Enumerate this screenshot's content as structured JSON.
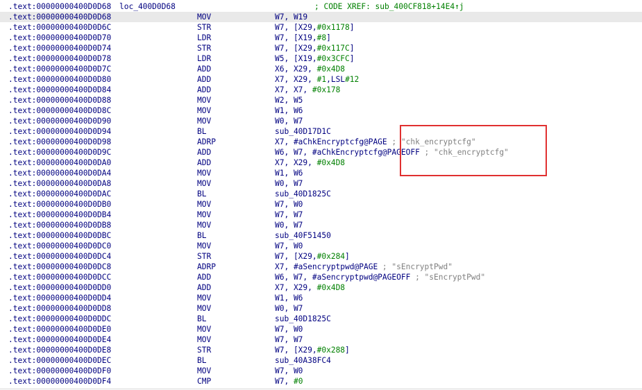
{
  "header": {
    "address": ".text:00000000400D0D68",
    "label": "loc_400D0D68",
    "xref": "; CODE XREF: sub_400CF818+14E4↑j"
  },
  "rows": [
    {
      "addr": ".text:00000000400D0D68",
      "mn": "MOV",
      "ops": "W7, W19",
      "highlighted": true
    },
    {
      "addr": ".text:00000000400D0D6C",
      "mn": "STR",
      "ops": "W7, [X29,#0x1178]"
    },
    {
      "addr": ".text:00000000400D0D70",
      "mn": "LDR",
      "ops": "W7, [X19,#8]"
    },
    {
      "addr": ".text:00000000400D0D74",
      "mn": "STR",
      "ops": "W7, [X29,#0x117C]"
    },
    {
      "addr": ".text:00000000400D0D78",
      "mn": "LDR",
      "ops": "W5, [X19,#0x3CFC]"
    },
    {
      "addr": ".text:00000000400D0D7C",
      "mn": "ADD",
      "ops": "X6, X29, #0x4D8"
    },
    {
      "addr": ".text:00000000400D0D80",
      "mn": "ADD",
      "ops": "X7, X29, #1,LSL#12"
    },
    {
      "addr": ".text:00000000400D0D84",
      "mn": "ADD",
      "ops": "X7, X7, #0x178"
    },
    {
      "addr": ".text:00000000400D0D88",
      "mn": "MOV",
      "ops": "W2, W5"
    },
    {
      "addr": ".text:00000000400D0D8C",
      "mn": "MOV",
      "ops": "W1, W6"
    },
    {
      "addr": ".text:00000000400D0D90",
      "mn": "MOV",
      "ops": "W0, W7"
    },
    {
      "addr": ".text:00000000400D0D94",
      "mn": "BL",
      "ops": "sub_40D17D1C"
    },
    {
      "addr": ".text:00000000400D0D98",
      "mn": "ADRP",
      "ops": "X7, #aChkEncryptcfg@PAGE",
      "comment": " ; \"chk_encryptcfg\""
    },
    {
      "addr": ".text:00000000400D0D9C",
      "mn": "ADD",
      "ops": "W6, W7, #aChkEncryptcfg@PAGEOFF",
      "comment": " ; \"chk_encryptcfg\""
    },
    {
      "addr": ".text:00000000400D0DA0",
      "mn": "ADD",
      "ops": "X7, X29, #0x4D8"
    },
    {
      "addr": ".text:00000000400D0DA4",
      "mn": "MOV",
      "ops": "W1, W6"
    },
    {
      "addr": ".text:00000000400D0DA8",
      "mn": "MOV",
      "ops": "W0, W7"
    },
    {
      "addr": ".text:00000000400D0DAC",
      "mn": "BL",
      "ops": "sub_40D1825C"
    },
    {
      "addr": ".text:00000000400D0DB0",
      "mn": "MOV",
      "ops": "W7, W0"
    },
    {
      "addr": ".text:00000000400D0DB4",
      "mn": "MOV",
      "ops": "W7, W7"
    },
    {
      "addr": ".text:00000000400D0DB8",
      "mn": "MOV",
      "ops": "W0, W7"
    },
    {
      "addr": ".text:00000000400D0DBC",
      "mn": "BL",
      "ops": "sub_40F51450"
    },
    {
      "addr": ".text:00000000400D0DC0",
      "mn": "MOV",
      "ops": "W7, W0"
    },
    {
      "addr": ".text:00000000400D0DC4",
      "mn": "STR",
      "ops": "W7, [X29,#0x284]"
    },
    {
      "addr": ".text:00000000400D0DC8",
      "mn": "ADRP",
      "ops": "X7, #aSencryptpwd@PAGE",
      "comment": " ; \"sEncryptPwd\""
    },
    {
      "addr": ".text:00000000400D0DCC",
      "mn": "ADD",
      "ops": "W6, W7, #aSencryptpwd@PAGEOFF",
      "comment": " ; \"sEncryptPwd\""
    },
    {
      "addr": ".text:00000000400D0DD0",
      "mn": "ADD",
      "ops": "X7, X29, #0x4D8"
    },
    {
      "addr": ".text:00000000400D0DD4",
      "mn": "MOV",
      "ops": "W1, W6"
    },
    {
      "addr": ".text:00000000400D0DD8",
      "mn": "MOV",
      "ops": "W0, W7"
    },
    {
      "addr": ".text:00000000400D0DDC",
      "mn": "BL",
      "ops": "sub_40D1825C"
    },
    {
      "addr": ".text:00000000400D0DE0",
      "mn": "MOV",
      "ops": "W7, W0"
    },
    {
      "addr": ".text:00000000400D0DE4",
      "mn": "MOV",
      "ops": "W7, W7"
    },
    {
      "addr": ".text:00000000400D0DE8",
      "mn": "STR",
      "ops": "W7, [X29,#0x288]"
    },
    {
      "addr": ".text:00000000400D0DEC",
      "mn": "BL",
      "ops": "sub_40A38FC4"
    },
    {
      "addr": ".text:00000000400D0DF0",
      "mn": "MOV",
      "ops": "W7, W0"
    },
    {
      "addr": ".text:00000000400D0DF4",
      "mn": "CMP",
      "ops": "W7, #0"
    }
  ],
  "colors": {
    "address": "#000080",
    "immediate": "#008000",
    "comment": "#808080",
    "highlight_row": "#e9e9e9",
    "annotation_box": "#e03030"
  }
}
